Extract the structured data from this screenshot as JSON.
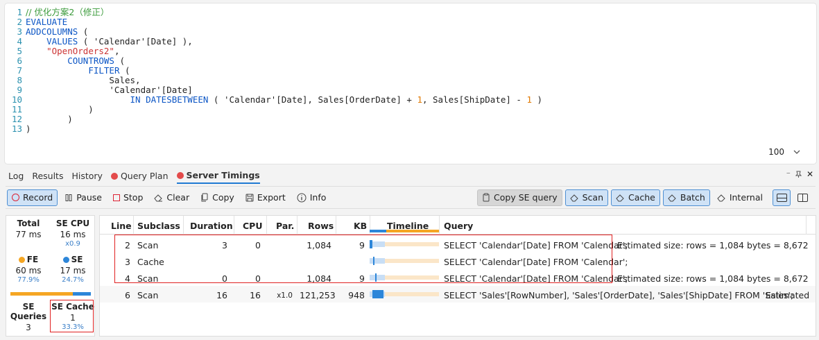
{
  "editor": {
    "lines": [
      {
        "num": "1",
        "tokens": [
          {
            "t": "// 优化方案2（修正）",
            "c": "comment"
          }
        ]
      },
      {
        "num": "2",
        "tokens": [
          {
            "t": "EVALUATE",
            "c": "kw"
          }
        ]
      },
      {
        "num": "3",
        "tokens": [
          {
            "t": "ADDCOLUMNS",
            "c": "kw"
          },
          {
            "t": " (",
            "c": "txt"
          }
        ]
      },
      {
        "num": "4",
        "tokens": [
          {
            "t": "    ",
            "c": "txt"
          },
          {
            "t": "VALUES",
            "c": "kw"
          },
          {
            "t": " ( 'Calendar'[Date] ),",
            "c": "txt"
          }
        ]
      },
      {
        "num": "5",
        "tokens": [
          {
            "t": "    ",
            "c": "txt"
          },
          {
            "t": "\"OpenOrders2\"",
            "c": "str"
          },
          {
            "t": ",",
            "c": "txt"
          }
        ]
      },
      {
        "num": "6",
        "tokens": [
          {
            "t": "        ",
            "c": "txt"
          },
          {
            "t": "COUNTROWS",
            "c": "kw"
          },
          {
            "t": " (",
            "c": "txt"
          }
        ]
      },
      {
        "num": "7",
        "tokens": [
          {
            "t": "            ",
            "c": "txt"
          },
          {
            "t": "FILTER",
            "c": "kw"
          },
          {
            "t": " (",
            "c": "txt"
          }
        ]
      },
      {
        "num": "8",
        "tokens": [
          {
            "t": "                Sales,",
            "c": "txt"
          }
        ]
      },
      {
        "num": "9",
        "tokens": [
          {
            "t": "                'Calendar'[Date]",
            "c": "txt"
          }
        ]
      },
      {
        "num": "10",
        "tokens": [
          {
            "t": "                    ",
            "c": "txt"
          },
          {
            "t": "IN DATESBETWEEN",
            "c": "kw"
          },
          {
            "t": " ( 'Calendar'[Date], Sales[OrderDate] + ",
            "c": "txt"
          },
          {
            "t": "1",
            "c": "num"
          },
          {
            "t": ", Sales[ShipDate] - ",
            "c": "txt"
          },
          {
            "t": "1",
            "c": "num"
          },
          {
            "t": " )",
            "c": "txt"
          }
        ]
      },
      {
        "num": "11",
        "tokens": [
          {
            "t": "            )",
            "c": "txt"
          }
        ]
      },
      {
        "num": "12",
        "tokens": [
          {
            "t": "        )",
            "c": "txt"
          }
        ]
      },
      {
        "num": "13",
        "tokens": [
          {
            "t": ")",
            "c": "txt"
          }
        ]
      }
    ],
    "zoom": "100"
  },
  "tabs": [
    {
      "label": "Log",
      "dot": false
    },
    {
      "label": "Results",
      "dot": false
    },
    {
      "label": "History",
      "dot": false
    },
    {
      "label": "Query Plan",
      "dot": true
    },
    {
      "label": "Server Timings",
      "dot": true
    }
  ],
  "panel_controls": {
    "more": "⁻",
    "pin": "⟂",
    "close": "✕"
  },
  "toolbar": {
    "record": "Record",
    "pause": "Pause",
    "stop": "Stop",
    "clear": "Clear",
    "copy": "Copy",
    "export": "Export",
    "info": "Info",
    "copy_se_query": "Copy SE query",
    "scan": "Scan",
    "cache": "Cache",
    "batch": "Batch",
    "internal": "Internal"
  },
  "summary": {
    "total_label": "Total",
    "total_value": "77 ms",
    "se_cpu_label": "SE CPU",
    "se_cpu_value": "16 ms",
    "se_cpu_ratio": "x0.9",
    "fe_label": "FE",
    "fe_value": "60 ms",
    "fe_pct": "77.9%",
    "fe_color": "#f5a623",
    "se_label": "SE",
    "se_value": "17 ms",
    "se_pct": "24.7%",
    "se_color": "#2d86d9",
    "fe_fraction": 0.779,
    "se_queries_label": "SE Queries",
    "se_queries_value": "3",
    "se_cache_label": "SE Cache",
    "se_cache_value": "1",
    "se_cache_pct": "33.3%"
  },
  "grid": {
    "columns": {
      "line": "Line",
      "subclass": "Subclass",
      "duration": "Duration",
      "cpu": "CPU",
      "par": "Par.",
      "rows": "Rows",
      "kb": "KB",
      "timeline": "Timeline",
      "query": "Query"
    },
    "rows": [
      {
        "line": "2",
        "subclass": "Scan",
        "duration": "3",
        "cpu": "0",
        "par": "",
        "rows": "1,084",
        "kb": "9",
        "query": "SELECT 'Calendar'[Date] FROM 'Calendar';",
        "extra": "Estimated size: rows = 1,084  bytes = 8,672",
        "tl_start": 0.0,
        "tl_end": 0.04
      },
      {
        "line": "3",
        "subclass": "Cache",
        "duration": "",
        "cpu": "",
        "par": "",
        "rows": "",
        "kb": "",
        "query": "SELECT 'Calendar'[Date] FROM 'Calendar';",
        "extra": "",
        "tl_start": 0.05,
        "tl_end": 0.06
      },
      {
        "line": "4",
        "subclass": "Scan",
        "duration": "0",
        "cpu": "0",
        "par": "",
        "rows": "1,084",
        "kb": "9",
        "query": "SELECT 'Calendar'[Date] FROM 'Calendar';",
        "extra": "Estimated size: rows = 1,084  bytes = 8,672",
        "tl_start": 0.08,
        "tl_end": 0.09
      },
      {
        "line": "6",
        "subclass": "Scan",
        "duration": "16",
        "cpu": "16",
        "par": "x1.0",
        "rows": "121,253",
        "kb": "948",
        "query": "SELECT 'Sales'[RowNumber], 'Sales'[OrderDate], 'Sales'[ShipDate] FROM 'Sales';",
        "extra": "Estimated",
        "tl_start": 0.04,
        "tl_end": 0.2
      }
    ]
  }
}
